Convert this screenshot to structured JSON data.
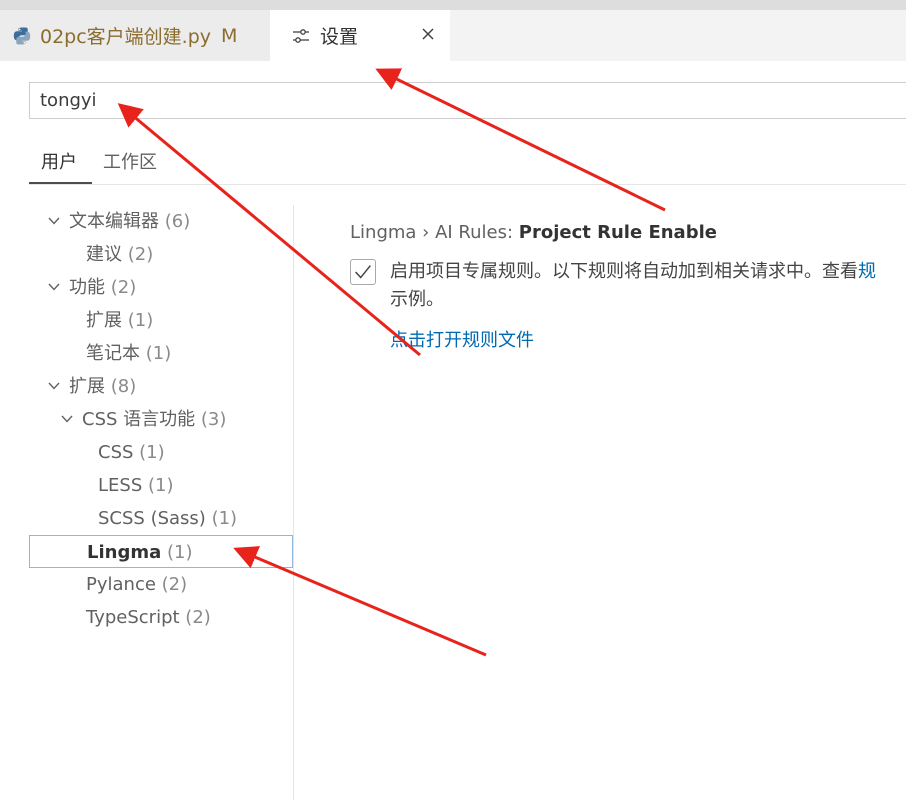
{
  "tabs": [
    {
      "label": "02pc客户端创建.py",
      "modified": "M",
      "icon": "python-icon"
    },
    {
      "label": "设置",
      "icon": "settings-icon",
      "close_icon": "close-icon"
    }
  ],
  "search": {
    "value": "tongyi"
  },
  "scope_tabs": [
    "用户",
    "工作区"
  ],
  "tree": [
    {
      "label": "文本编辑器",
      "count": "(6)"
    },
    {
      "label": "建议",
      "count": "(2)"
    },
    {
      "label": "功能",
      "count": "(2)"
    },
    {
      "label": "扩展",
      "count": "(1)"
    },
    {
      "label": "笔记本",
      "count": "(1)"
    },
    {
      "label": "扩展",
      "count": "(8)"
    },
    {
      "label": "CSS 语言功能",
      "count": "(3)"
    },
    {
      "label": "CSS",
      "count": "(1)"
    },
    {
      "label": "LESS",
      "count": "(1)"
    },
    {
      "label": "SCSS (Sass)",
      "count": "(1)"
    },
    {
      "label": "Lingma",
      "count": "(1)"
    },
    {
      "label": "Pylance",
      "count": "(2)"
    },
    {
      "label": "TypeScript",
      "count": "(2)"
    }
  ],
  "setting": {
    "category": "Lingma › AI Rules: ",
    "name": "Project Rule Enable",
    "checked": true,
    "description": "启用项目专属规则。以下规则将自动加到相关请求中。查看",
    "description_link": "规",
    "description_tail": "示例。",
    "link": "点击打开规则文件"
  },
  "colors": {
    "link": "#006ab1",
    "annotation_arrow": "#e8231c",
    "selected_border": "#8fb6e0"
  }
}
